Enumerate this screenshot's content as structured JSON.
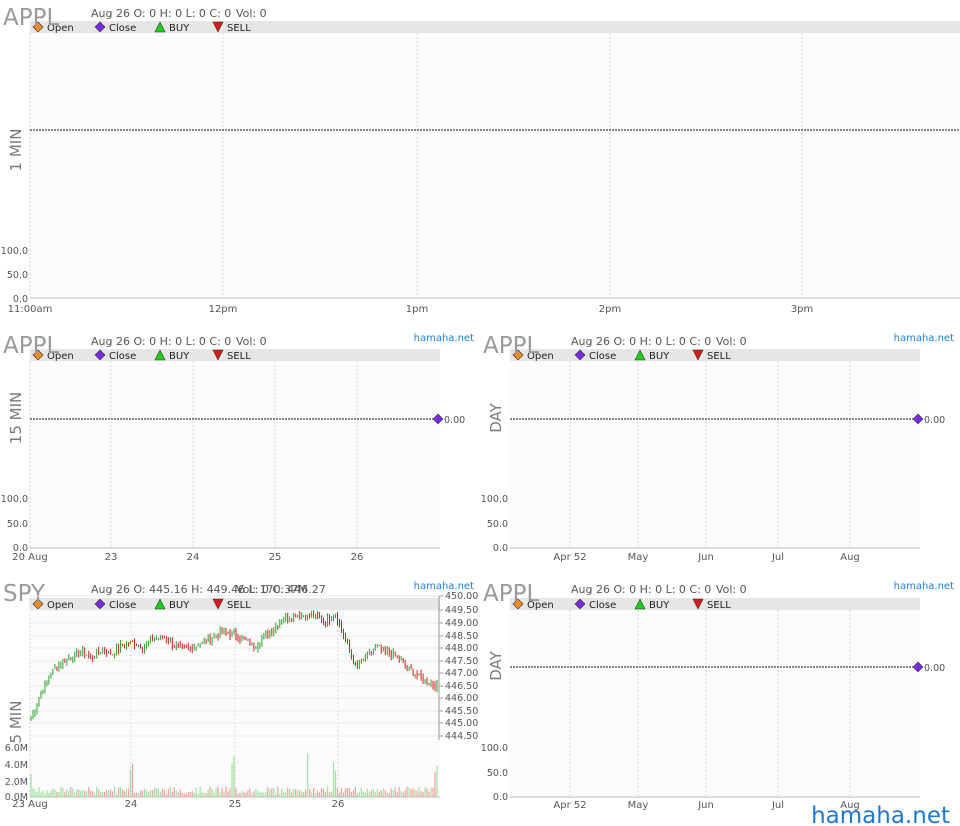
{
  "legend_items": [
    {
      "label": "Open",
      "icon": "diamond",
      "color": "#f28c28"
    },
    {
      "label": "Close",
      "icon": "diamond",
      "color": "#7a2be0"
    },
    {
      "label": "BUY",
      "icon": "triangle-up",
      "color": "#19d119"
    },
    {
      "label": "SELL",
      "icon": "triangle-down",
      "color": "#d81b1b"
    }
  ],
  "watermark": "hamaha.net",
  "colors": {
    "bar_up": "#2aa02a",
    "bar_down": "#c81e1e",
    "vol_up": "#9fe09f",
    "vol_down": "#f0a0a0",
    "legend_bg": "#e6e6e6"
  },
  "panels": [
    {
      "id": "p1",
      "symbol": "APPL",
      "ohlc": "Aug 26 O: 0 H: 0 L: 0 C: 0",
      "vol": "Vol: 0",
      "brand": "",
      "timeframe": "1 MIN",
      "y_ticks": [
        "100.0",
        "50.0",
        "0.0"
      ],
      "x_ticks": [
        "11:00am",
        "12pm",
        "1pm",
        "2pm",
        "3pm"
      ],
      "last_value": ""
    },
    {
      "id": "p2",
      "symbol": "APPL",
      "ohlc": "Aug 26 O: 0 H: 0 L: 0 C: 0",
      "vol": "Vol: 0",
      "brand": "hamaha.net",
      "timeframe": "15 MIN",
      "y_ticks": [
        "100.0",
        "50.0",
        "0.0"
      ],
      "x_ticks": [
        "20 Aug",
        "23",
        "24",
        "25",
        "26"
      ],
      "last_value": "0.00"
    },
    {
      "id": "p3",
      "symbol": "APPL",
      "ohlc": "Aug 26 O: 0 H: 0 L: 0 C: 0",
      "vol": "Vol: 0",
      "brand": "hamaha.net",
      "timeframe": "DAY",
      "y_ticks": [
        "100.0",
        "50.0",
        "0.0"
      ],
      "x_ticks": [
        "Apr 52",
        "May",
        "Jun",
        "Jul",
        "Aug"
      ],
      "last_value": "0.00"
    },
    {
      "id": "p4",
      "symbol": "SPY",
      "ohlc": "Aug 26 O: 445.16 H: 449.46 L: 0 C: 446.27",
      "vol": "Vol: 170.37M",
      "brand": "hamaha.net",
      "timeframe": "5 MIN",
      "y_ticks": [
        "450.00",
        "449.50",
        "449.00",
        "448.50",
        "448.00",
        "447.50",
        "447.00",
        "446.50",
        "446.00",
        "445.50",
        "445.00",
        "444.50"
      ],
      "vol_ticks": [
        "6.0M",
        "4.0M",
        "2.0M",
        "0.0M"
      ],
      "x_ticks": [
        "23 Aug",
        "24",
        "25",
        "26"
      ],
      "last_value": ""
    },
    {
      "id": "p5",
      "symbol": "APPL",
      "ohlc": "Aug 26 O: 0 H: 0 L: 0 C: 0",
      "vol": "Vol: 0",
      "brand": "hamaha.net",
      "timeframe": "DAY",
      "y_ticks": [
        "100.0",
        "50.0",
        "0.0"
      ],
      "x_ticks": [
        "Apr 52",
        "May",
        "Jun",
        "Jul",
        "Aug"
      ],
      "last_value": "0.00"
    }
  ],
  "chart_data": [
    {
      "type": "line",
      "title": "APPL 1 MIN",
      "ylim": [
        0,
        100
      ],
      "x": [],
      "series": []
    },
    {
      "type": "line",
      "title": "APPL 15 MIN",
      "ylim": [
        0,
        100
      ],
      "x": [],
      "series": [],
      "last": 0.0
    },
    {
      "type": "line",
      "title": "APPL DAY",
      "ylim": [
        0,
        100
      ],
      "x": [],
      "series": [],
      "last": 0.0
    },
    {
      "type": "candlestick",
      "title": "SPY 5 MIN",
      "ylim": [
        444.5,
        450.0
      ],
      "categories": [
        "23 Aug",
        "24",
        "25",
        "26"
      ],
      "series": [
        {
          "values": [
            445.2,
            446.2,
            447.0,
            447.4,
            447.6,
            447.8,
            447.6,
            447.9,
            447.7,
            448.1,
            448.2,
            448.0,
            448.3,
            448.4,
            448.1,
            447.9,
            448.0,
            448.2,
            448.4,
            448.6,
            448.5,
            448.3,
            448.0,
            448.4,
            448.8,
            449.1,
            449.3,
            449.2,
            449.2,
            449.0,
            449.3,
            448.2,
            447.2,
            447.6,
            448.0,
            447.8,
            447.6,
            447.2,
            446.9,
            446.6,
            446.5
          ]
        }
      ],
      "volume_ylim": [
        0,
        6000000
      ]
    },
    {
      "type": "line",
      "title": "APPL DAY",
      "ylim": [
        0,
        100
      ],
      "x": [],
      "series": [],
      "last": 0.0
    }
  ]
}
